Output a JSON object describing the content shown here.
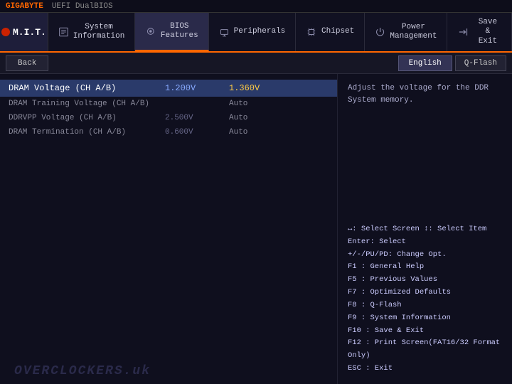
{
  "topbar": {
    "brand": "GIGABYTE",
    "bios": "UEFI DualBIOS"
  },
  "nav": {
    "mit_label": "M.I.T.",
    "items": [
      {
        "id": "system-information",
        "icon": "ℹ",
        "line1": "System",
        "line2": "Information"
      },
      {
        "id": "bios-features",
        "icon": "⚙",
        "line1": "BIOS",
        "line2": "Features"
      },
      {
        "id": "peripherals",
        "icon": "🔌",
        "line1": "",
        "line2": "Peripherals"
      },
      {
        "id": "chipset",
        "icon": "💾",
        "line1": "",
        "line2": "Chipset"
      },
      {
        "id": "power-management",
        "icon": "⚡",
        "line1": "Power",
        "line2": "Management"
      },
      {
        "id": "save-exit",
        "icon": "↩",
        "line1": "Save &",
        "line2": "Exit"
      }
    ]
  },
  "toolbar": {
    "back_label": "Back",
    "english_label": "English",
    "qflash_label": "Q-Flash"
  },
  "table": {
    "highlighted_row": {
      "col1": "DRAM Voltage        (CH A/B)",
      "col2": "1.200V",
      "col3": "1.360V"
    },
    "rows": [
      {
        "col1": "DRAM Training Voltage  (CH A/B)",
        "col2": "",
        "col3": "Auto"
      },
      {
        "col1": "DDRVPP Voltage  (CH A/B)",
        "col2": "2.500V",
        "col3": "Auto"
      },
      {
        "col1": "DRAM Termination  (CH A/B)",
        "col2": "0.600V",
        "col3": "Auto"
      }
    ]
  },
  "description": {
    "text": "Adjust the voltage for the DDR System memory."
  },
  "help": {
    "lines": [
      {
        "key": "↔",
        "desc": ": Select Screen  ↕: Select Item"
      },
      {
        "key": "Enter",
        "desc": ": Select"
      },
      {
        "key": "+/-/PU/PD",
        "desc": ": Change Opt."
      },
      {
        "key": "F1",
        "desc": " : General Help"
      },
      {
        "key": "F5",
        "desc": " : Previous Values"
      },
      {
        "key": "F7",
        "desc": " : Optimized Defaults"
      },
      {
        "key": "F8",
        "desc": " : Q-Flash"
      },
      {
        "key": "F9",
        "desc": " : System Information"
      },
      {
        "key": "F10",
        "desc": " : Save & Exit"
      },
      {
        "key": "F12",
        "desc": " : Print Screen(FAT16/32 Format Only)"
      },
      {
        "key": "ESC",
        "desc": " : Exit"
      }
    ]
  },
  "watermark": "OVERCLOCKERS.uk"
}
